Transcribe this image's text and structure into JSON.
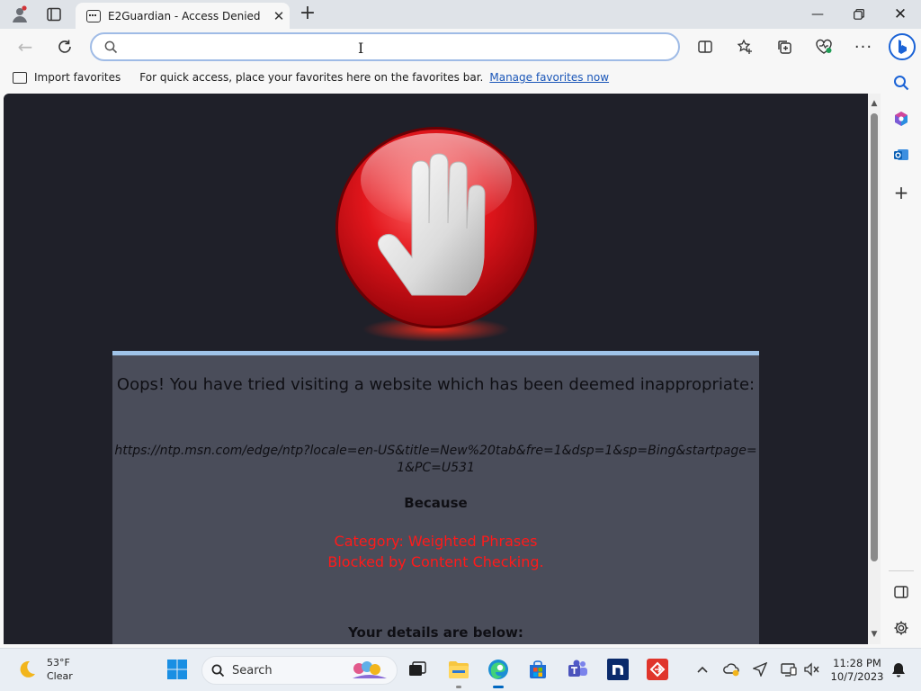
{
  "browser": {
    "tab_title": "E2Guardian - Access Denied",
    "address_value": "",
    "address_placeholder": ""
  },
  "favorites_bar": {
    "import_label": "Import favorites",
    "tip_text": "For quick access, place your favorites here on the favorites bar.",
    "manage_link": "Manage favorites now"
  },
  "page": {
    "heading": "Oops! You have tried visiting a website which has been deemed inappropriate:",
    "blocked_url": "https://ntp.msn.com/edge/ntp?locale=en-US&title=New%20tab&fre=1&dsp=1&sp=Bing&startpage=1&PC=U531",
    "because_label": "Because",
    "reason_line1": "Category: Weighted Phrases",
    "reason_line2": "Blocked by Content Checking.",
    "details_label": "Your details are below:"
  },
  "taskbar": {
    "weather_temp": "53°F",
    "weather_cond": "Clear",
    "search_label": "Search",
    "time": "11:28 PM",
    "date": "10/7/2023"
  },
  "colors": {
    "page_background": "#1f2029",
    "panel_background": "#4a4d5a",
    "panel_accent": "#9fc3e8",
    "reason_text": "#ff1a1a",
    "link": "#1a56b8"
  },
  "icons": [
    "profile-icon",
    "tab-actions-icon",
    "page-favicon",
    "tab-close-icon",
    "new-tab-icon",
    "minimize-icon",
    "restore-icon",
    "window-close-icon",
    "back-icon",
    "refresh-icon",
    "search-icon",
    "split-screen-icon",
    "add-favorite-icon",
    "collections-icon",
    "browser-essentials-icon",
    "more-icon",
    "copilot-icon",
    "stop-hand-icon",
    "sidebar-search-icon",
    "office-icon",
    "outlook-icon",
    "add-sidebar-app-icon",
    "hide-sidebar-icon",
    "sidebar-settings-icon",
    "moon-weather-icon",
    "windows-start-icon",
    "file-explorer-icon",
    "edge-icon",
    "store-icon",
    "teams-icon",
    "n-app-icon",
    "remote-app-icon",
    "chevron-up-icon",
    "onedrive-icon",
    "location-icon",
    "display-icon",
    "volume-muted-icon",
    "notification-icon"
  ]
}
